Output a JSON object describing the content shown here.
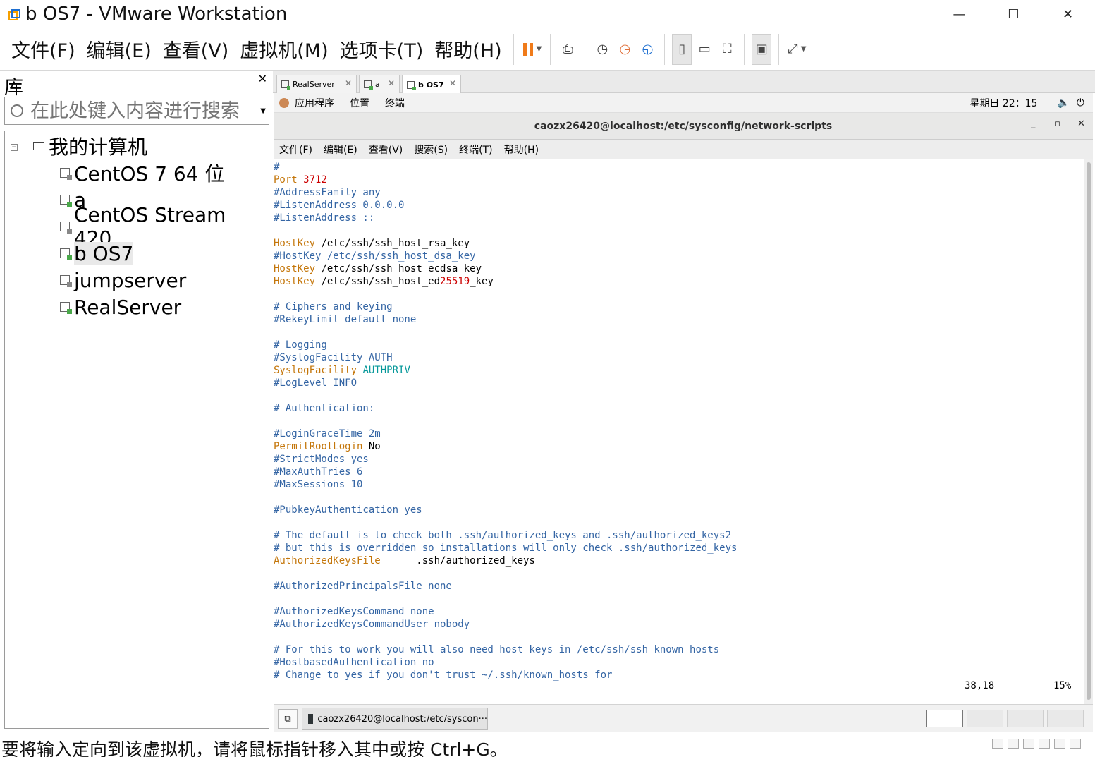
{
  "window": {
    "title": "b OS7 - VMware Workstation",
    "controls": {
      "minimize": "—",
      "maximize": "☐",
      "close": "✕"
    }
  },
  "menu": [
    "文件(F)",
    "编辑(E)",
    "查看(V)",
    "虚拟机(M)",
    "选项卡(T)",
    "帮助(H)"
  ],
  "toolbar_icons": [
    "pause-icon",
    "send-ctrl-alt-del-icon",
    "snapshot-icon",
    "revert-snapshot-icon",
    "manage-snapshots-icon",
    "library-view-icon",
    "thumbnail-view-icon",
    "fullscreen-icon",
    "console-view-icon",
    "stretch-icon"
  ],
  "library": {
    "title": "库",
    "close": "✕",
    "search_placeholder": "在此处键入内容进行搜索",
    "root": "我的计算机",
    "items": [
      "CentOS 7 64 位",
      "a",
      "CentOS Stream 420",
      "b OS7",
      "jumpserver",
      "RealServer"
    ],
    "selected": "b OS7"
  },
  "tabs": [
    {
      "label": "RealServer"
    },
    {
      "label": "a"
    },
    {
      "label": "b OS7",
      "active": true
    }
  ],
  "guest_topbar": {
    "apps": "应用程序",
    "places": "位置",
    "terminal": "终端",
    "clock": "星期日 22：15"
  },
  "terminal": {
    "title": "caozx26420@localhost:/etc/sysconfig/network-scripts",
    "controls": {
      "minimize": "_",
      "maximize": "▫",
      "close": "✕"
    },
    "menu": [
      "文件(F)",
      "编辑(E)",
      "查看(V)",
      "搜索(S)",
      "终端(T)",
      "帮助(H)"
    ],
    "lines": [
      "#",
      "Port 3712",
      "#AddressFamily any",
      "#ListenAddress 0.0.0.0",
      "#ListenAddress ::",
      "",
      "HostKey /etc/ssh/ssh_host_rsa_key",
      "#HostKey /etc/ssh/ssh_host_dsa_key",
      "HostKey /etc/ssh/ssh_host_ecdsa_key",
      "HostKey /etc/ssh/ssh_host_ed25519_key",
      "",
      "# Ciphers and keying",
      "#RekeyLimit default none",
      "",
      "# Logging",
      "#SyslogFacility AUTH",
      "SyslogFacility AUTHPRIV",
      "#LogLevel INFO",
      "",
      "# Authentication:",
      "",
      "#LoginGraceTime 2m",
      "PermitRootLogin No",
      "#StrictModes yes",
      "#MaxAuthTries 6",
      "#MaxSessions 10",
      "",
      "#PubkeyAuthentication yes",
      "",
      "# The default is to check both .ssh/authorized_keys and .ssh/authorized_keys2",
      "# but this is overridden so installations will only check .ssh/authorized_keys",
      "AuthorizedKeysFile      .ssh/authorized_keys",
      "",
      "#AuthorizedPrincipalsFile none",
      "",
      "#AuthorizedKeysCommand none",
      "#AuthorizedKeysCommandUser nobody",
      "",
      "# For this to work you will also need host keys in /etc/ssh/ssh_known_hosts",
      "#HostbasedAuthentication no",
      "# Change to yes if you don't trust ~/.ssh/known_hosts for"
    ],
    "status_pos": "38,18",
    "status_pct": "15%"
  },
  "taskbar": {
    "task_label": "caozx26420@localhost:/etc/syscon···"
  },
  "host_status": {
    "message": "要将输入定向到该虚拟机，请将鼠标指针移入其中或按 Ctrl+G。"
  },
  "colors": {
    "comment": "#3465a4",
    "keyword": "#c4760a",
    "number": "#c00000",
    "value": "#06989a",
    "pause_accent": "#f07b1a"
  }
}
